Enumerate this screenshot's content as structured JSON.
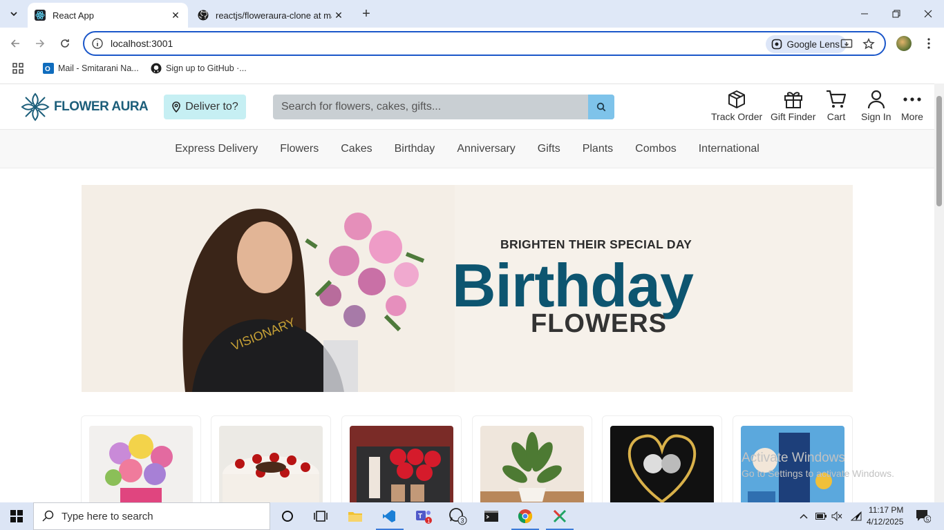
{
  "browser": {
    "tabs": [
      {
        "title": "React App",
        "active": true
      },
      {
        "title": "reactjs/floweraura-clone at mas"
      }
    ],
    "url": "localhost:3001",
    "lens_label": "Google Lens",
    "bookmarks": [
      {
        "label": "Mail - Smitarani Na..."
      },
      {
        "label": "Sign up to GitHub ·..."
      }
    ]
  },
  "site": {
    "logo_text": "FLOWER AURA",
    "deliver_label": "Deliver to?",
    "search_placeholder": "Search for flowers, cakes, gifts...",
    "actions": [
      {
        "label": "Track Order",
        "icon": "box-icon"
      },
      {
        "label": "Gift Finder",
        "icon": "gift-icon"
      },
      {
        "label": "Cart",
        "icon": "cart-icon"
      },
      {
        "label": "Sign In",
        "icon": "user-icon"
      },
      {
        "label": "More",
        "icon": "more-dots-icon"
      }
    ],
    "categories": [
      "Express Delivery",
      "Flowers",
      "Cakes",
      "Birthday",
      "Anniversary",
      "Gifts",
      "Plants",
      "Combos",
      "International"
    ],
    "banner": {
      "pre": "BRIGHTEN THEIR SPECIAL DAY",
      "main": "Birthday",
      "sub": "FLOWERS"
    },
    "cards": [
      "flowers-bouquet",
      "black-forest-cake",
      "roses-hamper",
      "potted-plant",
      "couple-frame",
      "personalized-gifts"
    ]
  },
  "watermark": {
    "title": "Activate Windows",
    "text": "Go to Settings to activate Windows."
  },
  "taskbar": {
    "search_placeholder": "Type here to search",
    "time": "11:17 PM",
    "date": "4/12/2025",
    "teams_badge": "1",
    "whatsapp_badge": "3",
    "notif_count": "5"
  },
  "colors": {
    "brand": "#1c5e7a",
    "deliver_bg": "#c6eff3",
    "search_btn": "#7ec3ea",
    "banner_bg": "#f6f1ea"
  }
}
